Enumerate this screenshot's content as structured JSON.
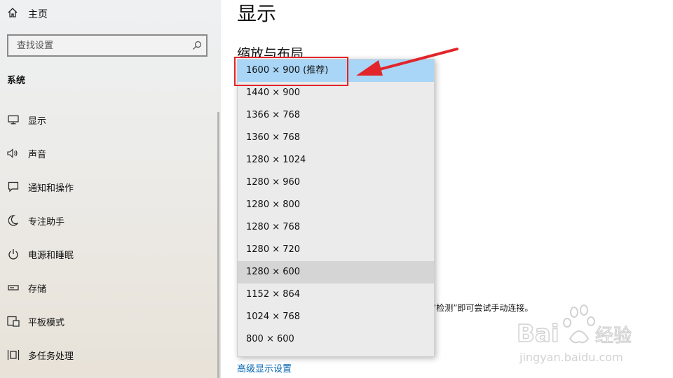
{
  "sidebar": {
    "home": {
      "label": "主页",
      "icon": "home-icon"
    },
    "search": {
      "placeholder": "查找设置",
      "icon": "search-icon"
    },
    "section_label": "系统",
    "items": [
      {
        "label": "显示",
        "icon": "monitor-icon"
      },
      {
        "label": "声音",
        "icon": "speaker-icon"
      },
      {
        "label": "通知和操作",
        "icon": "message-icon"
      },
      {
        "label": "专注助手",
        "icon": "moon-icon"
      },
      {
        "label": "电源和睡眠",
        "icon": "power-icon"
      },
      {
        "label": "存储",
        "icon": "storage-icon"
      },
      {
        "label": "平板模式",
        "icon": "tablet-icon"
      },
      {
        "label": "多任务处理",
        "icon": "multitask-icon"
      }
    ]
  },
  "main": {
    "title": "显示",
    "section_heading": "缩放与布局",
    "body_text_fragment": "“检测”即可尝试手动连接。",
    "advanced_link": "高级显示设置"
  },
  "resolution_dropdown": {
    "selected": "1600 × 900 (推荐)",
    "hovered": "1280 × 600",
    "options": [
      "1600 × 900 (推荐)",
      "1440 × 900",
      "1366 × 768",
      "1360 × 768",
      "1280 × 1024",
      "1280 × 960",
      "1280 × 800",
      "1280 × 768",
      "1280 × 720",
      "1280 × 600",
      "1152 × 864",
      "1024 × 768",
      "800 × 600"
    ]
  },
  "annotation": {
    "color": "#e1252a"
  },
  "watermark": {
    "brand": "Baidu",
    "brand_suffix": "经验",
    "url": "jingyan.baidu.com"
  },
  "colors": {
    "selected_bg": "#a9d6f7",
    "link": "#0063b1",
    "sidebar_bg": "#eceae6"
  }
}
